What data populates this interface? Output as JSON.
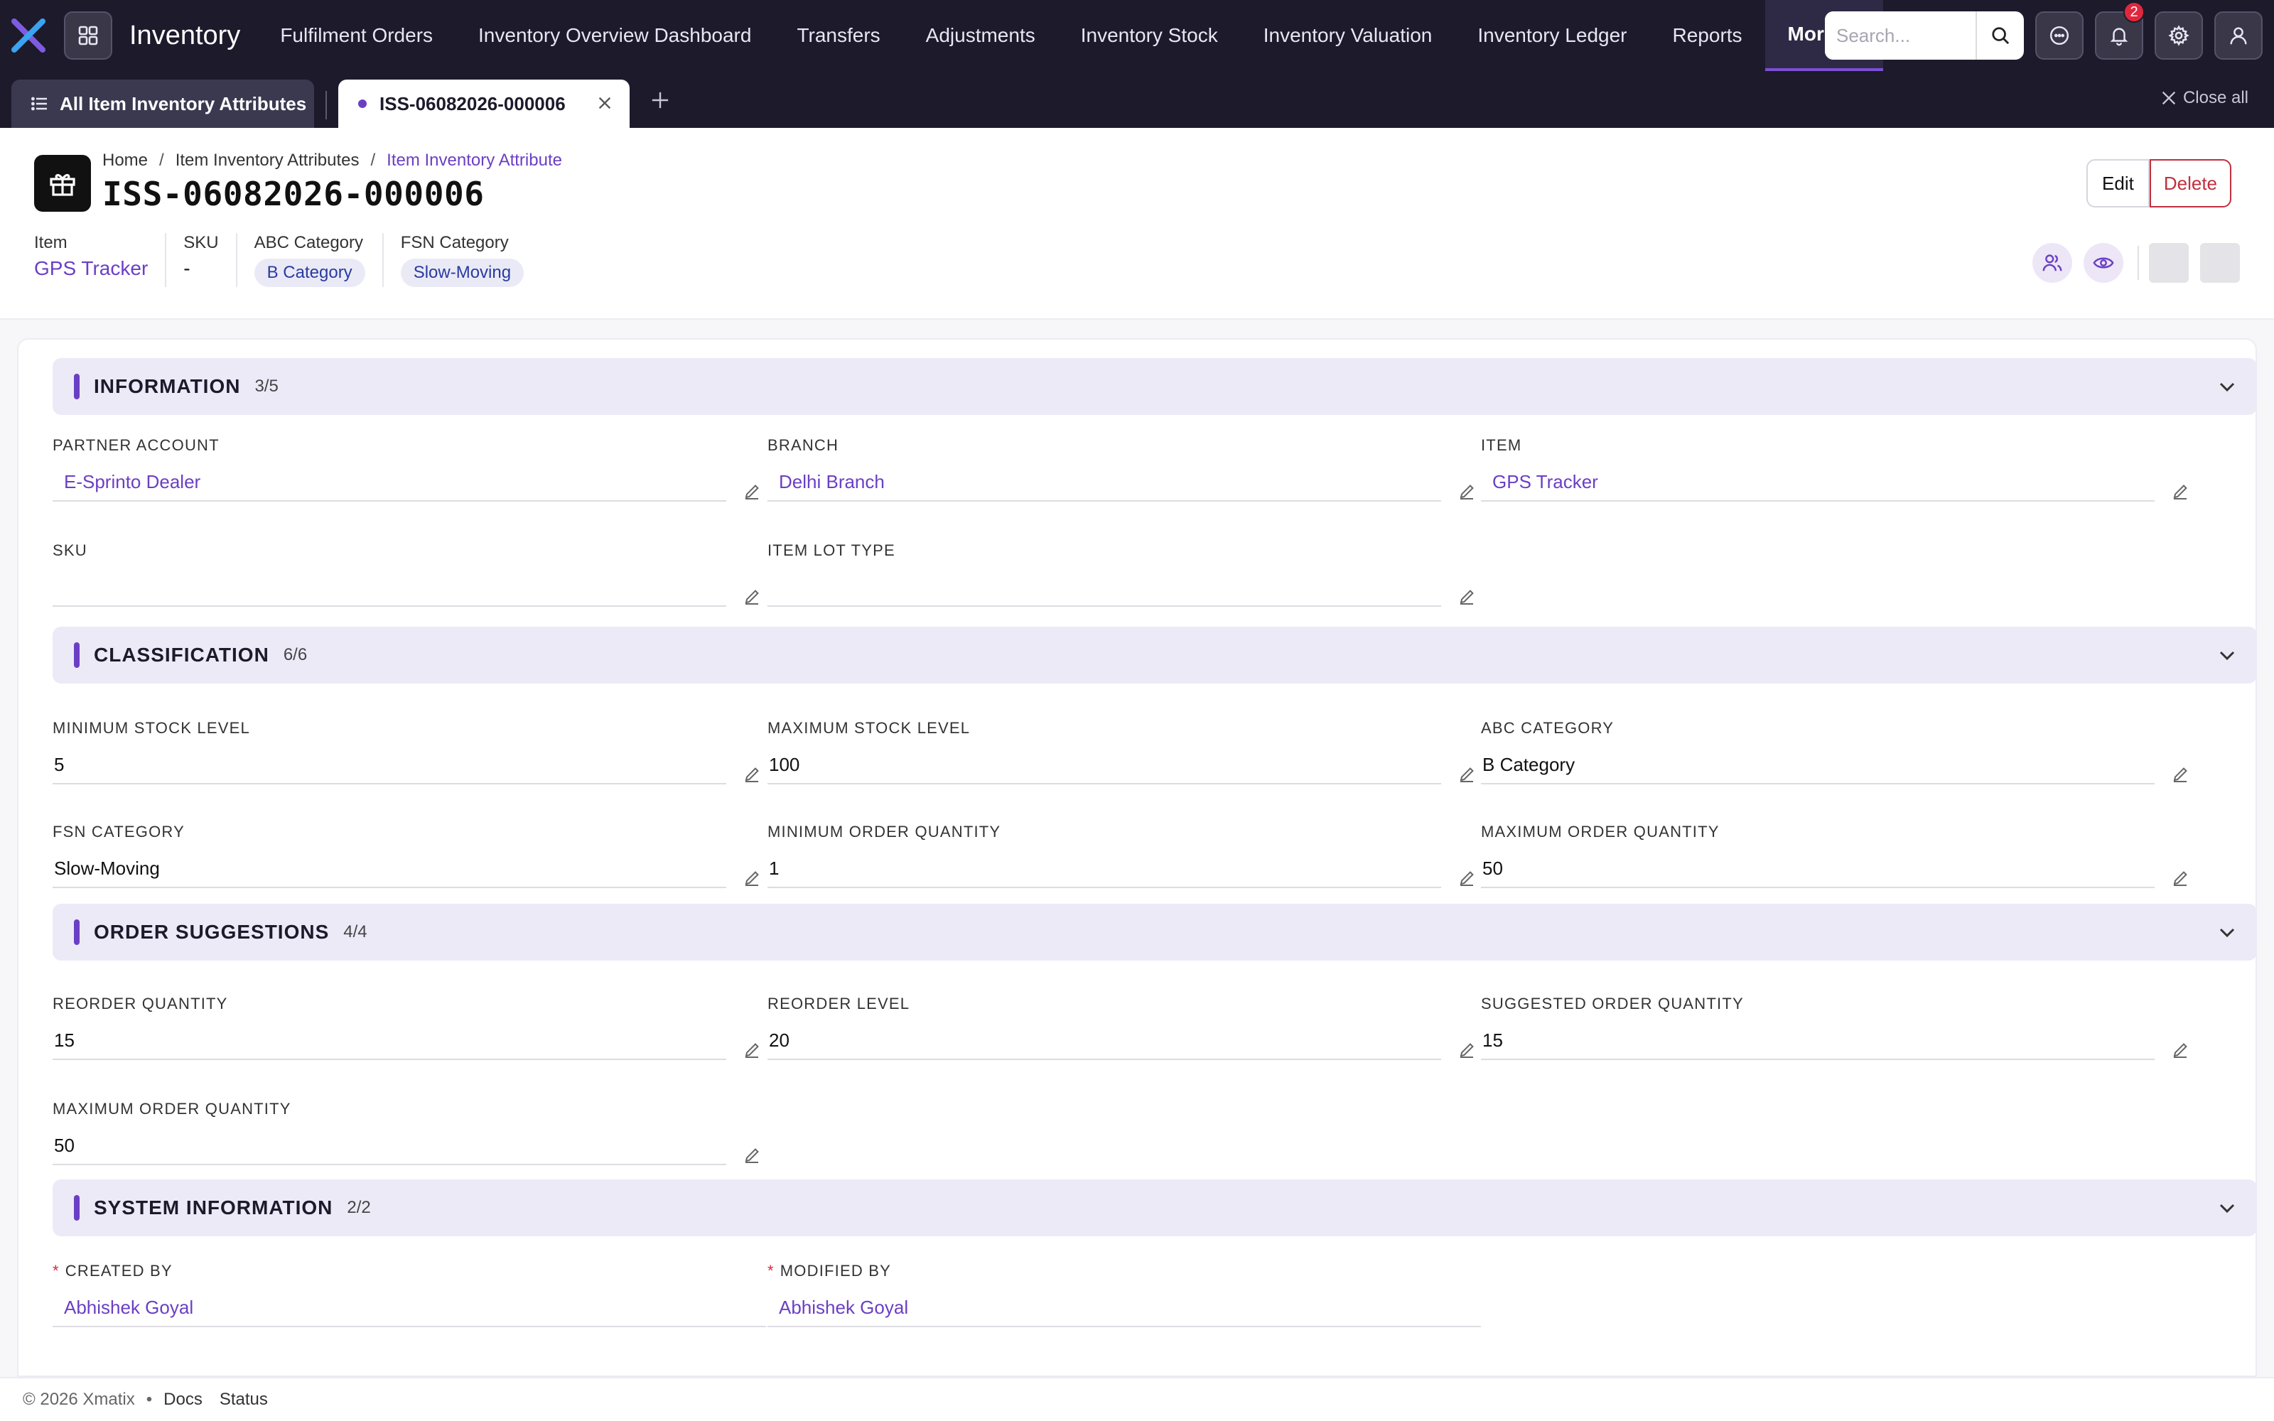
{
  "app": {
    "title": "Inventory"
  },
  "nav": {
    "items": [
      {
        "label": "Fulfilment Orders"
      },
      {
        "label": "Inventory Overview Dashboard"
      },
      {
        "label": "Transfers"
      },
      {
        "label": "Adjustments"
      },
      {
        "label": "Inventory Stock"
      },
      {
        "label": "Inventory Valuation"
      },
      {
        "label": "Inventory Ledger"
      },
      {
        "label": "Reports"
      }
    ],
    "more_label": "More",
    "search_placeholder": "Search...",
    "notification_count": "2"
  },
  "tabs": {
    "all_label": "All Item Inventory Attributes",
    "active_label": "ISS-06082026-000006",
    "close_all_label": "Close all"
  },
  "header": {
    "breadcrumb": [
      "Home",
      "Item Inventory Attributes",
      "Item Inventory Attribute"
    ],
    "breadcrumb_sep": "/",
    "title": "ISS-06082026-000006",
    "edit_label": "Edit",
    "delete_label": "Delete",
    "meta": {
      "item_label": "Item",
      "item_value": "GPS Tracker",
      "sku_label": "SKU",
      "sku_value": "-",
      "abc_label": "ABC Category",
      "abc_value": "B Category",
      "fsn_label": "FSN Category",
      "fsn_value": "Slow-Moving"
    }
  },
  "sections": {
    "information": {
      "title": "INFORMATION",
      "count": "3/5",
      "partner_account_label": "PARTNER ACCOUNT",
      "partner_account_value": "E-Sprinto Dealer",
      "branch_label": "BRANCH",
      "branch_value": "Delhi Branch",
      "item_label": "ITEM",
      "item_value": "GPS Tracker",
      "sku_label": "SKU",
      "sku_value": "",
      "item_lot_type_label": "ITEM LOT TYPE",
      "item_lot_type_value": ""
    },
    "classification": {
      "title": "CLASSIFICATION",
      "count": "6/6",
      "min_stock_label": "MINIMUM STOCK LEVEL",
      "min_stock_value": "5",
      "max_stock_label": "MAXIMUM STOCK LEVEL",
      "max_stock_value": "100",
      "abc_label": "ABC CATEGORY",
      "abc_value": "B Category",
      "fsn_label": "FSN CATEGORY",
      "fsn_value": "Slow-Moving",
      "min_order_label": "MINIMUM ORDER QUANTITY",
      "min_order_value": "1",
      "max_order_label": "MAXIMUM ORDER QUANTITY",
      "max_order_value": "50"
    },
    "order_suggestions": {
      "title": "ORDER SUGGESTIONS",
      "count": "4/4",
      "reorder_qty_label": "REORDER QUANTITY",
      "reorder_qty_value": "15",
      "reorder_level_label": "REORDER LEVEL",
      "reorder_level_value": "20",
      "suggested_qty_label": "SUGGESTED ORDER QUANTITY",
      "suggested_qty_value": "15",
      "max_order_label": "MAXIMUM ORDER QUANTITY",
      "max_order_value": "50"
    },
    "system_information": {
      "title": "SYSTEM INFORMATION",
      "count": "2/2",
      "created_by_label": "CREATED BY",
      "created_by_value": "Abhishek Goyal",
      "modified_by_label": "MODIFIED BY",
      "modified_by_value": "Abhishek Goyal"
    }
  },
  "footer": {
    "copyright": "© 2026 Xmatix",
    "docs_label": "Docs",
    "status_label": "Status"
  },
  "colors": {
    "accent": "#6b3fc4",
    "nav_bg": "#1c1a2b",
    "danger": "#c0303e",
    "section_bg": "#eceaf7"
  }
}
